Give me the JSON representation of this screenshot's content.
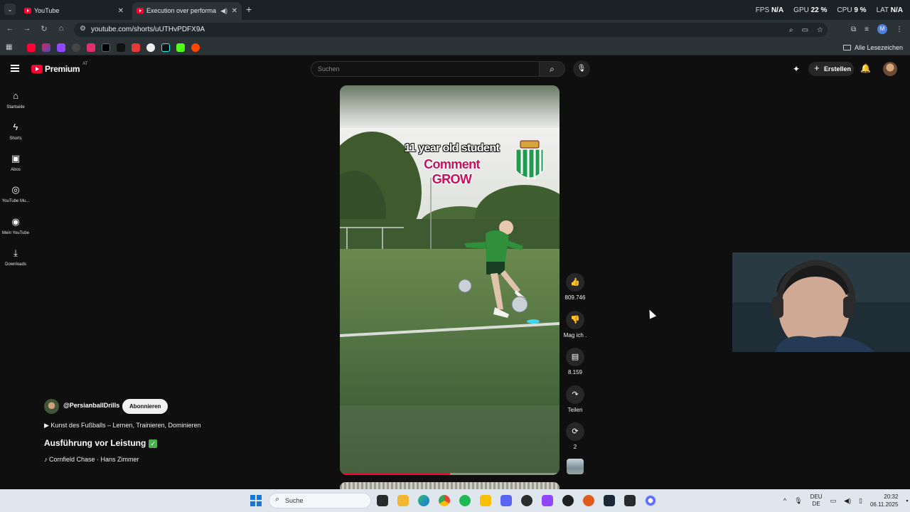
{
  "browser": {
    "tabs": [
      {
        "title": "YouTube",
        "active": false
      },
      {
        "title": "Execution over performance",
        "active": true
      }
    ],
    "url": "youtube.com/shorts/uUTHvPDFX9A",
    "bookmarks_all_label": "Alle Lesezeichen",
    "profile_initial": "M"
  },
  "overlay_stats": {
    "fps_label": "FPS",
    "fps_value": "N/A",
    "gpu_label": "GPU",
    "gpu_value": "22 %",
    "cpu_label": "CPU",
    "cpu_value": "9 %",
    "lat_label": "LAT",
    "lat_value": "N/A"
  },
  "youtube": {
    "logo_text": "Premium",
    "country_code": "AT",
    "search_placeholder": "Suchen",
    "create_label": "Erstellen",
    "guide": [
      {
        "label": "Startseite",
        "icon": "home-icon"
      },
      {
        "label": "Shorts",
        "icon": "shorts-icon"
      },
      {
        "label": "Abos",
        "icon": "subscriptions-icon"
      },
      {
        "label": "YouTube Mu...",
        "icon": "youtube-music-icon"
      },
      {
        "label": "Mein YouTube",
        "icon": "my-youtube-icon"
      },
      {
        "label": "Downloads",
        "icon": "downloads-icon"
      }
    ]
  },
  "short": {
    "overlay_line1": "11 year old student",
    "overlay_line2": "Comment GROW",
    "progress": 0.5,
    "channel": "@PersianballDrills",
    "subscribe_label": "Abonnieren",
    "description": "▶ Kunst des Fußballs – Lernen, Trainieren, Dominieren",
    "title": "Ausführung vor Leistung",
    "music": "♪ Cornfield Chase · Hans Zimmer",
    "actions": {
      "likes": "809.746",
      "dislike_label": "Mag ich .",
      "comments": "8.159",
      "share_label": "Teilen",
      "remix_count": "2"
    }
  },
  "taskbar": {
    "search_label": "Suche",
    "language_top": "DEU",
    "language_bottom": "DE",
    "time": "20:32",
    "date": "06.11.2025"
  },
  "colors": {
    "yt_red": "#ff0033",
    "overlay_pink": "#c8115b",
    "background": "#0f0f0f"
  }
}
